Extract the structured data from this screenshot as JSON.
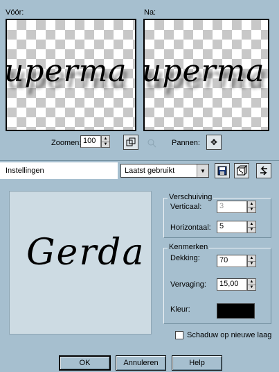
{
  "before_label": "Vóór:",
  "after_label": "Na:",
  "preview_text": "uperma",
  "zoom_label": "Zoomen:",
  "zoom_value": "100",
  "pan_label": "Pannen:",
  "settings_label": "Instellingen",
  "preset_value": "Laatst gebruikt",
  "sample_text": "Gerda",
  "offset_group": "Verschuiving",
  "vertical_label": "Verticaal:",
  "vertical_value": "3",
  "horizontal_label": "Horizontaal:",
  "horizontal_value": "5",
  "props_group": "Kenmerken",
  "opacity_label": "Dekking:",
  "opacity_value": "70",
  "blur_label": "Vervaging:",
  "blur_value": "15,00",
  "color_label": "Kleur:",
  "shadow_color": "#000000",
  "new_layer_label": "Schaduw op nieuwe laag",
  "new_layer_checked": false,
  "ok_label": "OK",
  "cancel_label": "Annuleren",
  "help_label": "Help",
  "colors": {
    "background": "#a6bfcf",
    "panel": "#cddbe3"
  }
}
